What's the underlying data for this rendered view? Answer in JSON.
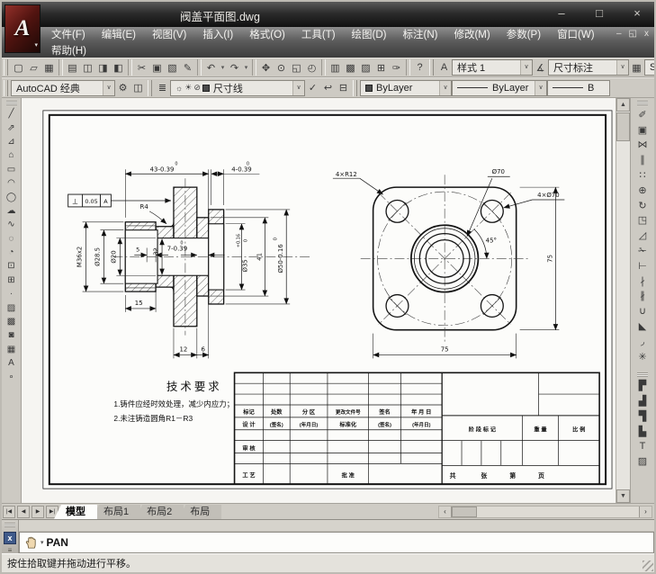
{
  "window": {
    "title": "阀盖平面图.dwg",
    "logo_letter": "A",
    "controls": [
      {
        "name": "minimize-button",
        "glyph": "–"
      },
      {
        "name": "maximize-button",
        "glyph": "□"
      },
      {
        "name": "close-button",
        "glyph": "×"
      }
    ],
    "mdi_controls": [
      {
        "name": "mdi-minimize-button",
        "glyph": "–"
      },
      {
        "name": "mdi-restore-button",
        "glyph": "◱"
      },
      {
        "name": "mdi-close-button",
        "glyph": "x"
      }
    ]
  },
  "menu": {
    "items": [
      {
        "name": "menu-file",
        "label": "文件(F)"
      },
      {
        "name": "menu-edit",
        "label": "编辑(E)"
      },
      {
        "name": "menu-view",
        "label": "视图(V)"
      },
      {
        "name": "menu-insert",
        "label": "插入(I)"
      },
      {
        "name": "menu-format",
        "label": "格式(O)"
      },
      {
        "name": "menu-tools",
        "label": "工具(T)"
      },
      {
        "name": "menu-draw",
        "label": "绘图(D)"
      },
      {
        "name": "menu-dimension",
        "label": "标注(N)"
      },
      {
        "name": "menu-modify",
        "label": "修改(M)"
      },
      {
        "name": "menu-parametric",
        "label": "参数(P)"
      },
      {
        "name": "menu-window",
        "label": "窗口(W)"
      }
    ],
    "help_item": "帮助(H)"
  },
  "toolbars": {
    "standard": [
      {
        "name": "new-file-icon",
        "glyph": "▢"
      },
      {
        "name": "open-file-icon",
        "glyph": "▱"
      },
      {
        "name": "save-icon",
        "glyph": "▦"
      },
      {
        "cls": "sep"
      },
      {
        "name": "plot-icon",
        "glyph": "▤"
      },
      {
        "name": "plot-preview-icon",
        "glyph": "◫"
      },
      {
        "name": "publish-icon",
        "glyph": "◨"
      },
      {
        "name": "batch-plot-icon",
        "glyph": "◧"
      },
      {
        "cls": "sep"
      },
      {
        "name": "cut-icon",
        "glyph": "✂"
      },
      {
        "name": "copy-icon",
        "glyph": "▣"
      },
      {
        "name": "paste-icon",
        "glyph": "▧"
      },
      {
        "name": "match-properties-icon",
        "glyph": "✎"
      },
      {
        "cls": "sep"
      },
      {
        "name": "undo-icon",
        "glyph": "↶"
      },
      {
        "name": "undo-dropdown-icon",
        "glyph": "▾",
        "cls": "narrow"
      },
      {
        "name": "redo-icon",
        "glyph": "↷"
      },
      {
        "name": "redo-dropdown-icon",
        "glyph": "▾",
        "cls": "narrow"
      },
      {
        "cls": "sep"
      },
      {
        "name": "pan-icon",
        "glyph": "✥"
      },
      {
        "name": "zoom-realtime-icon",
        "glyph": "⊙"
      },
      {
        "name": "zoom-window-icon",
        "glyph": "◱"
      },
      {
        "name": "zoom-previous-icon",
        "glyph": "◴"
      },
      {
        "cls": "sep"
      },
      {
        "name": "properties-icon",
        "glyph": "▥"
      },
      {
        "name": "designcenter-icon",
        "glyph": "▩"
      },
      {
        "name": "tool-palettes-icon",
        "glyph": "▨"
      },
      {
        "name": "sheet-set-manager-icon",
        "glyph": "⊞"
      },
      {
        "name": "markup-set-manager-icon",
        "glyph": "✑"
      },
      {
        "cls": "sep"
      },
      {
        "name": "help-icon",
        "glyph": "?"
      }
    ],
    "text_style_icon": "A",
    "text_style": "样式 1",
    "dim_style_icon": "∡",
    "dim_style": "尺寸标注",
    "table_style_icon": "▦",
    "table_style": "Stand",
    "workspace": "AutoCAD 经典",
    "workspace_icons": [
      {
        "name": "workspace-settings-icon",
        "glyph": "⚙"
      },
      {
        "name": "window-layout-icon",
        "glyph": "◫"
      }
    ],
    "layer_manager_icon": {
      "glyph": "≣"
    },
    "layer_state_icons": {
      "on": "☼",
      "freeze": "☀",
      "lock": "⊘"
    },
    "layer_name": "尺寸线",
    "layer_tool_icons": [
      {
        "name": "make-object-layer-current-icon",
        "glyph": "✓"
      },
      {
        "name": "layer-previous-icon",
        "glyph": "↩"
      },
      {
        "name": "layer-states-icon",
        "glyph": "⊟"
      }
    ],
    "color_value": "ByLayer",
    "linetype_value": "ByLayer",
    "lineweight_value": "B",
    "combo_caret": "∨"
  },
  "draw_toolbar": [
    {
      "name": "line-icon",
      "glyph": "╱"
    },
    {
      "name": "construction-line-icon",
      "glyph": "⇗"
    },
    {
      "name": "polyline-icon",
      "glyph": "⊿"
    },
    {
      "name": "polygon-icon",
      "glyph": "⌂"
    },
    {
      "name": "rectangle-icon",
      "glyph": "▭"
    },
    {
      "name": "arc-icon",
      "glyph": "◠"
    },
    {
      "name": "circle-icon",
      "glyph": "◯"
    },
    {
      "name": "revision-cloud-icon",
      "glyph": "☁"
    },
    {
      "name": "spline-icon",
      "glyph": "∿"
    },
    {
      "name": "ellipse-icon",
      "glyph": "◌"
    },
    {
      "name": "ellipse-arc-icon",
      "glyph": "◔"
    },
    {
      "name": "insert-block-icon",
      "glyph": "⊡"
    },
    {
      "name": "make-block-icon",
      "glyph": "⊞"
    },
    {
      "name": "point-icon",
      "glyph": "∙"
    },
    {
      "name": "hatch-icon",
      "glyph": "▨"
    },
    {
      "name": "gradient-icon",
      "glyph": "▩"
    },
    {
      "name": "region-icon",
      "glyph": "◙"
    },
    {
      "name": "table-icon",
      "glyph": "▦"
    },
    {
      "name": "multiline-text-icon",
      "glyph": "A"
    },
    {
      "name": "add-selected-icon",
      "glyph": "∘"
    }
  ],
  "modify_toolbar": [
    {
      "name": "erase-icon",
      "glyph": "✐"
    },
    {
      "name": "copy-object-icon",
      "glyph": "▣"
    },
    {
      "name": "mirror-icon",
      "glyph": "⋈"
    },
    {
      "name": "offset-icon",
      "glyph": "∥"
    },
    {
      "name": "array-icon",
      "glyph": "∷"
    },
    {
      "name": "move-icon",
      "glyph": "⊕"
    },
    {
      "name": "rotate-icon",
      "glyph": "↻"
    },
    {
      "name": "scale-icon",
      "glyph": "◳"
    },
    {
      "name": "stretch-icon",
      "glyph": "◿"
    },
    {
      "name": "trim-icon",
      "glyph": "✁"
    },
    {
      "name": "extend-icon",
      "glyph": "⊢"
    },
    {
      "name": "break-at-point-icon",
      "glyph": "∤"
    },
    {
      "name": "break-icon",
      "glyph": "∦"
    },
    {
      "name": "join-icon",
      "glyph": "∪"
    },
    {
      "name": "chamfer-icon",
      "glyph": "◣"
    },
    {
      "name": "fillet-icon",
      "glyph": "◞"
    },
    {
      "name": "explode-icon",
      "glyph": "✳"
    }
  ],
  "draworder_toolbar": [
    {
      "name": "bring-to-front-icon",
      "glyph": "▛"
    },
    {
      "name": "send-to-back-icon",
      "glyph": "▟"
    },
    {
      "name": "bring-above-objects-icon",
      "glyph": "▜"
    },
    {
      "name": "send-under-objects-icon",
      "glyph": "▙"
    },
    {
      "name": "text-to-front-icon",
      "glyph": "T"
    },
    {
      "name": "hatch-to-back-icon",
      "glyph": "▨"
    }
  ],
  "tabs": {
    "nav": [
      {
        "name": "tab-nav-first",
        "glyph": "|◀"
      },
      {
        "name": "tab-nav-prev",
        "glyph": "◀"
      },
      {
        "name": "tab-nav-next",
        "glyph": "▶"
      },
      {
        "name": "tab-nav-last",
        "glyph": "▶|"
      }
    ],
    "items": [
      {
        "name": "tab-model",
        "label": "模型",
        "cls": "active"
      },
      {
        "name": "tab-layout1",
        "label": "布局1"
      },
      {
        "name": "tab-layout2",
        "label": "布局2"
      },
      {
        "name": "tab-layout",
        "label": "布局"
      }
    ]
  },
  "command": {
    "label": "PAN"
  },
  "statusbar": {
    "message": "按住拾取键并拖动进行平移。"
  },
  "drawing": {
    "left_view": {
      "dim43_tol": "0",
      "dim43": "43-0.39",
      "dim4_tol": "0",
      "dim4": "4-0.39",
      "gdt_sym": "⊥",
      "gdt_val": "0.05",
      "gdt_datum": "A",
      "r4": "R4",
      "m36": "M36x2",
      "d285": "Ø28.5",
      "d20": "Ø20",
      "dim5": "5",
      "dim32": "32",
      "dim7_tol": "0",
      "dim7": "7-0.39",
      "d35": "Ø35",
      "d35_tol_top": "+0.16",
      "d35_tol_bot": "0",
      "dim41": "41",
      "d50": "Ø50-0.16",
      "d50_tol": "0",
      "dim15": "15",
      "dim12": "12",
      "dim6": "6"
    },
    "right_view": {
      "r12": "4×R12",
      "d70": "Ø70",
      "holes": "4×Ø70",
      "angle": "45°",
      "h75": "75",
      "w75": "75"
    },
    "tech": {
      "title": "技术要求",
      "line1": "1.铸件应经时效处理，减少内应力；",
      "line2": "2.未注铸造圆角R1－R3"
    },
    "title_block": {
      "h1": "标记",
      "h2": "处数",
      "h3": "分 区",
      "h4": "更改文件号",
      "h5": "签名",
      "h6": "年 月 日",
      "d1": "设 计",
      "d2": "(签名)",
      "d3": "(年月日)",
      "d4": "标准化",
      "d5": "(签名)",
      "d6": "(年月日)",
      "shenhe": "审 核",
      "gongyi": "工 艺",
      "pizhun": "批 准",
      "jieduan": "阶 段 标 记",
      "weight": "重 量",
      "scale": "比 例",
      "g1": "共",
      "g2": "张",
      "g3": "第",
      "g4": "页"
    }
  }
}
